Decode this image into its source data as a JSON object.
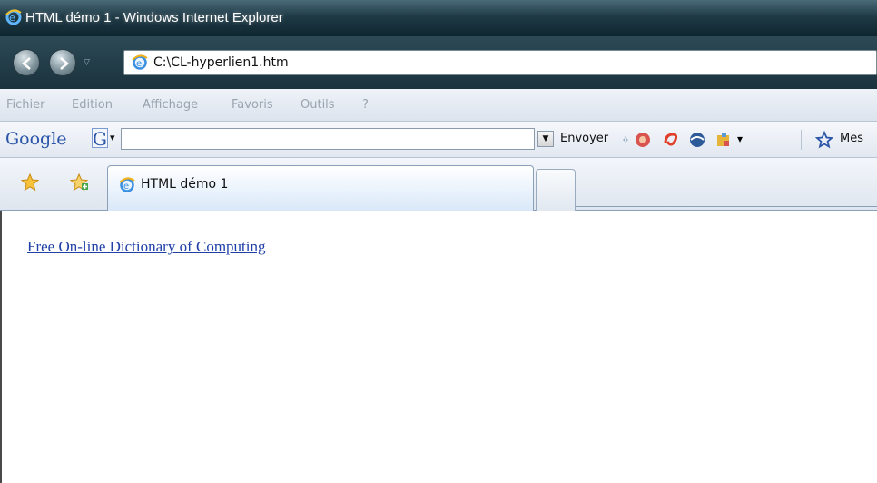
{
  "window": {
    "title": "HTML démo 1 - Windows Internet Explorer"
  },
  "navigation": {
    "back_icon": "back-arrow-icon",
    "forward_icon": "forward-arrow-icon",
    "dropdown_icon": "chevron-down-icon",
    "address": "C:\\CL-hyperlien1.htm"
  },
  "menubar": {
    "items": [
      "Fichier",
      "Edition",
      "Affichage",
      "Favoris",
      "Outils",
      "?"
    ]
  },
  "google_toolbar": {
    "logo": "Google",
    "g_button": "G",
    "search_value": "",
    "envoyer_label": "Envoyer",
    "mes_label": "Mes"
  },
  "tabs": {
    "active_label": "HTML démo 1"
  },
  "content": {
    "link_text": "Free On-line Dictionary of Computing"
  },
  "colors": {
    "link": "#2040a8",
    "titlebar": "#1f3a46"
  }
}
